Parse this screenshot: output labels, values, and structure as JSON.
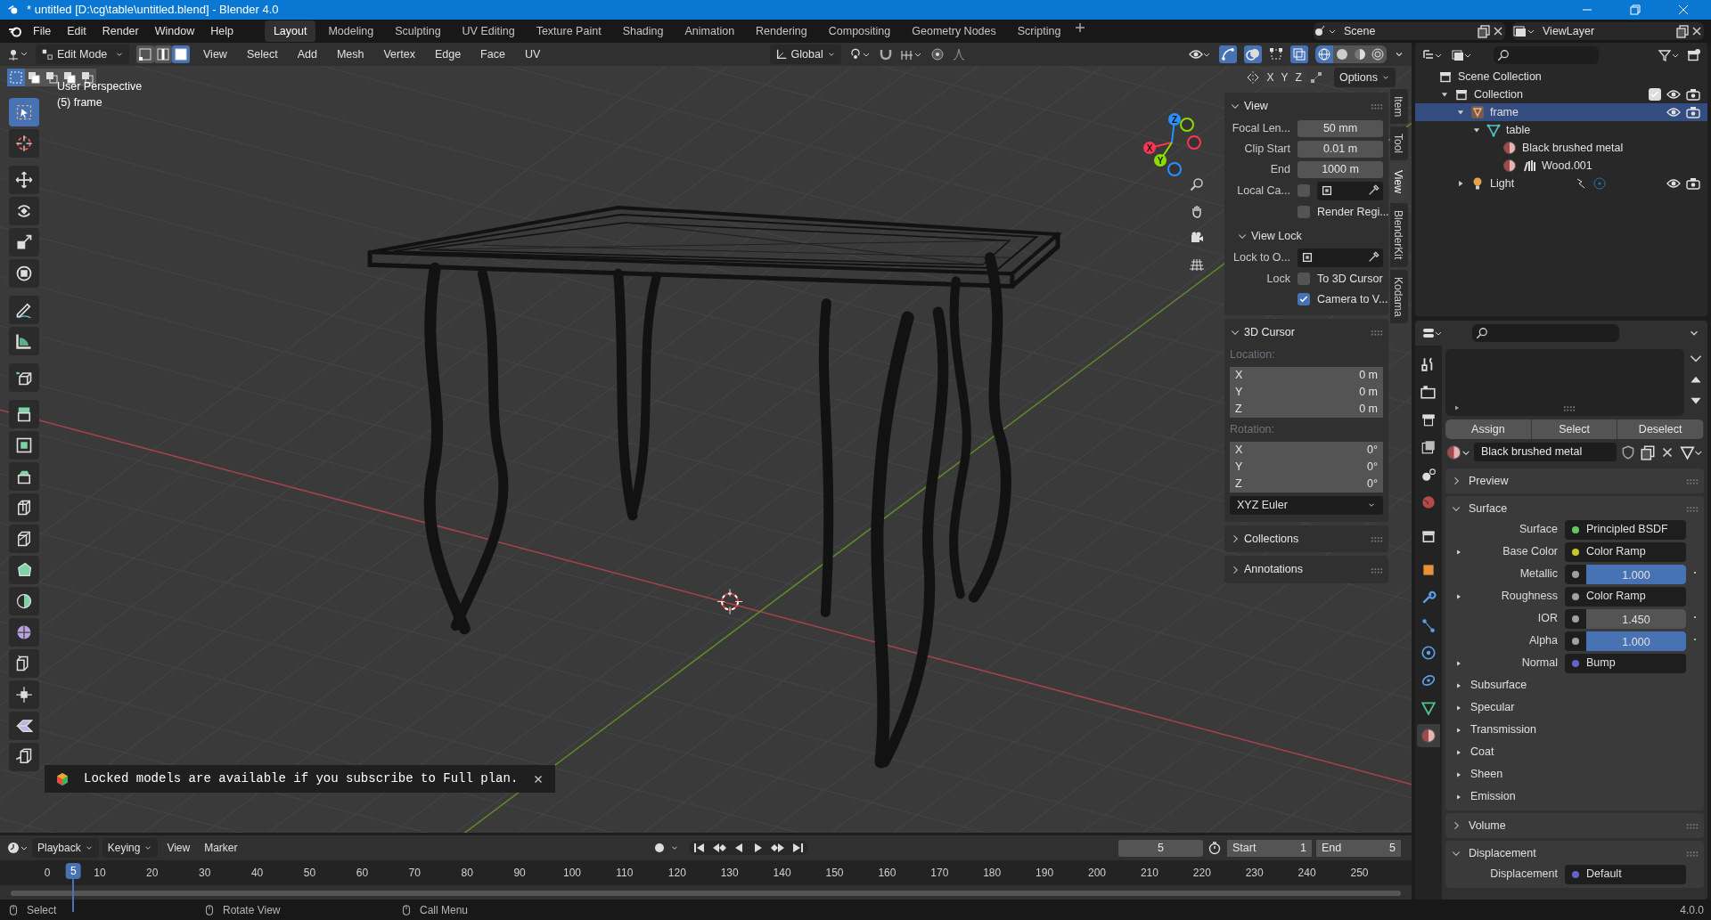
{
  "title_bar": {
    "title": "* untitled [D:\\cg\\table\\untitled.blend] - Blender 4.0"
  },
  "menu": [
    "File",
    "Edit",
    "Render",
    "Window",
    "Help"
  ],
  "workspaces": [
    {
      "label": "Layout",
      "selected": true
    },
    {
      "label": "Modeling",
      "selected": false
    },
    {
      "label": "Sculpting",
      "selected": false
    },
    {
      "label": "UV Editing",
      "selected": false
    },
    {
      "label": "Texture Paint",
      "selected": false
    },
    {
      "label": "Shading",
      "selected": false
    },
    {
      "label": "Animation",
      "selected": false
    },
    {
      "label": "Rendering",
      "selected": false
    },
    {
      "label": "Compositing",
      "selected": false
    },
    {
      "label": "Geometry Nodes",
      "selected": false
    },
    {
      "label": "Scripting",
      "selected": false
    }
  ],
  "scene": "Scene",
  "view_layer": "ViewLayer",
  "header": {
    "mode": "Edit Mode",
    "select_modes": [
      {
        "kind": "vertex",
        "selected": false
      },
      {
        "kind": "edge",
        "selected": false
      },
      {
        "kind": "face",
        "selected": true
      }
    ],
    "menus": [
      "View",
      "Select",
      "Add",
      "Mesh",
      "Vertex",
      "Edge",
      "Face",
      "UV"
    ],
    "orientation": "Global",
    "shading": [
      {
        "kind": "wireframe",
        "selected": true
      },
      {
        "kind": "solid",
        "selected": false
      },
      {
        "kind": "material",
        "selected": false
      },
      {
        "kind": "rendered",
        "selected": false
      }
    ]
  },
  "tool_header": {
    "box_modes": [
      {
        "selected": true
      },
      {
        "selected": false
      },
      {
        "selected": false
      },
      {
        "selected": false
      },
      {
        "selected": false
      }
    ],
    "mirror": [
      "X",
      "Y",
      "Z"
    ],
    "options": "Options"
  },
  "viewport": {
    "perspective": "User Perspective",
    "object": "(5) frame",
    "gizmo": [
      {
        "label": "X",
        "color": "#ff3352"
      },
      {
        "label": "Y",
        "color": "#8bdc00"
      },
      {
        "label": "Z",
        "color": "#2890ff"
      }
    ]
  },
  "tools": [
    {
      "kind": "select",
      "selected": true
    },
    {
      "kind": "cursor",
      "selected": false
    },
    {
      "kind": "move",
      "selected": false
    },
    {
      "kind": "rotate",
      "selected": false
    },
    {
      "kind": "scale",
      "selected": false
    },
    {
      "kind": "transform",
      "selected": false
    },
    {
      "kind": "annotate",
      "selected": false
    },
    {
      "kind": "measure",
      "selected": false
    },
    {
      "kind": "add_cube",
      "selected": false
    },
    {
      "kind": "extrude",
      "selected": false
    },
    {
      "kind": "inset",
      "selected": false
    },
    {
      "kind": "bevel",
      "selected": false
    },
    {
      "kind": "loopcut",
      "selected": false
    },
    {
      "kind": "knife",
      "selected": false
    },
    {
      "kind": "polybuild",
      "selected": false
    },
    {
      "kind": "spin",
      "selected": false
    },
    {
      "kind": "smooth",
      "selected": false
    },
    {
      "kind": "slide",
      "selected": false
    },
    {
      "kind": "shrink",
      "selected": false
    },
    {
      "kind": "shear",
      "selected": false
    },
    {
      "kind": "rip",
      "selected": false
    }
  ],
  "notification": {
    "text": "Locked models are available if you subscribe to Full plan."
  },
  "sidebar": {
    "tabs": [
      {
        "label": "Item",
        "selected": false
      },
      {
        "label": "Tool",
        "selected": false
      },
      {
        "label": "View",
        "selected": true
      },
      {
        "label": "BlenderKit",
        "selected": false
      },
      {
        "label": "Kodama",
        "selected": false
      }
    ],
    "panels": [
      {
        "title": "View",
        "expanded": true,
        "rows": [
          {
            "kind": "number",
            "label": "Focal Len...",
            "value": "50 mm"
          },
          {
            "kind": "number",
            "label": "Clip Start",
            "value": "0.01 m"
          },
          {
            "kind": "number",
            "label": "End",
            "value": "1000 m"
          },
          {
            "kind": "check_object",
            "label": "Local Ca...",
            "checked": false
          },
          {
            "kind": "checkbox",
            "text": "Render Regi...",
            "checked": false
          },
          {
            "kind": "subheader",
            "title": "View Lock",
            "expanded": true
          },
          {
            "kind": "object",
            "label": "Lock to O..."
          },
          {
            "kind": "checkbox",
            "label": "Lock",
            "text": "To 3D Cursor",
            "checked": false
          },
          {
            "kind": "checkbox",
            "text": "Camera to V...",
            "checked": true
          }
        ]
      },
      {
        "title": "3D Cursor",
        "expanded": true,
        "rows": [
          {
            "kind": "heading",
            "text": "Location:"
          },
          {
            "kind": "vector",
            "axis": "X",
            "value": "0 m"
          },
          {
            "kind": "vector",
            "axis": "Y",
            "value": "0 m"
          },
          {
            "kind": "vector",
            "axis": "Z",
            "value": "0 m"
          },
          {
            "kind": "heading",
            "text": "Rotation:"
          },
          {
            "kind": "vector",
            "axis": "X",
            "value": "0°"
          },
          {
            "kind": "vector",
            "axis": "Y",
            "value": "0°"
          },
          {
            "kind": "vector",
            "axis": "Z",
            "value": "0°"
          },
          {
            "kind": "dropdown",
            "value": "XYZ Euler"
          }
        ]
      },
      {
        "title": "Collections",
        "expanded": false
      },
      {
        "title": "Annotations",
        "expanded": false
      }
    ]
  },
  "outliner": {
    "items": [
      {
        "label": "Scene Collection",
        "kind": "scene",
        "selected": false,
        "children": [
          {
            "label": "Collection",
            "kind": "collection",
            "expanded": true,
            "checked": true,
            "selected": false,
            "children": [
              {
                "label": "frame",
                "kind": "object",
                "expanded": true,
                "selected": true,
                "children": [
                  {
                    "label": "table",
                    "kind": "mesh",
                    "expanded": true,
                    "selected": false,
                    "children": [
                      {
                        "label": "Black brushed metal",
                        "kind": "material",
                        "selected": false
                      },
                      {
                        "label": "Wood.001",
                        "kind": "material_texture",
                        "selected": false
                      }
                    ]
                  }
                ]
              },
              {
                "label": "Light",
                "kind": "light",
                "expanded": false,
                "selected": false
              }
            ]
          }
        ]
      }
    ]
  },
  "properties": {
    "tabs": [
      {
        "kind": "tool",
        "selected": false
      },
      {
        "kind": "render",
        "selected": false
      },
      {
        "kind": "output",
        "selected": false
      },
      {
        "kind": "view_layer",
        "selected": false
      },
      {
        "kind": "scene",
        "selected": false
      },
      {
        "kind": "world",
        "selected": false
      },
      {
        "kind": "collection",
        "selected": false
      },
      {
        "kind": "object",
        "selected": false
      },
      {
        "kind": "modifier",
        "selected": false
      },
      {
        "kind": "particles",
        "selected": false
      },
      {
        "kind": "physics",
        "selected": false
      },
      {
        "kind": "constraints",
        "selected": false
      },
      {
        "kind": "data",
        "selected": false
      },
      {
        "kind": "material",
        "selected": true
      }
    ],
    "slot_buttons": [
      "Assign",
      "Select",
      "Deselect"
    ],
    "material": "Black brushed metal",
    "panels": [
      {
        "title": "Preview",
        "expanded": false
      },
      {
        "title": "Surface",
        "expanded": true,
        "rows": [
          {
            "kind": "link",
            "label": "Surface",
            "value": "Principled BSDF",
            "color": "#63c763",
            "expandable": false
          },
          {
            "kind": "link",
            "label": "Base Color",
            "value": "Color Ramp",
            "color": "#c7c729",
            "expandable": true
          },
          {
            "kind": "slider",
            "label": "Metallic",
            "value": "1.000",
            "level": 1,
            "color": "#a1a1a1"
          },
          {
            "kind": "link",
            "label": "Roughness",
            "value": "Color Ramp",
            "color": "#a1a1a1",
            "expandable": true
          },
          {
            "kind": "number",
            "label": "IOR",
            "value": "1.450",
            "color": "#a1a1a1"
          },
          {
            "kind": "slider",
            "label": "Alpha",
            "value": "1.000",
            "level": 1,
            "color": "#a1a1a1"
          },
          {
            "kind": "link",
            "label": "Normal",
            "value": "Bump",
            "color": "#6363c7",
            "expandable": true
          },
          {
            "kind": "sub",
            "label": "Subsurface"
          },
          {
            "kind": "sub",
            "label": "Specular"
          },
          {
            "kind": "sub",
            "label": "Transmission"
          },
          {
            "kind": "sub",
            "label": "Coat"
          },
          {
            "kind": "sub",
            "label": "Sheen"
          },
          {
            "kind": "sub",
            "label": "Emission"
          }
        ]
      },
      {
        "title": "Volume",
        "expanded": false
      },
      {
        "title": "Displacement",
        "expanded": true,
        "rows": [
          {
            "kind": "link",
            "label": "Displacement",
            "value": "Default",
            "color": "#6363c7",
            "expandable": false
          }
        ]
      }
    ]
  },
  "timeline": {
    "menus": [
      {
        "label": "Playback",
        "kind": "dropdown"
      },
      {
        "label": "Keying",
        "kind": "dropdown"
      },
      {
        "label": "View",
        "kind": "menu"
      },
      {
        "label": "Marker",
        "kind": "menu"
      }
    ],
    "current_frame": "5",
    "start_label": "Start",
    "start": "1",
    "end_label": "End",
    "end": "5",
    "ticks": [
      "0",
      "10",
      "20",
      "30",
      "40",
      "50",
      "60",
      "70",
      "80",
      "90",
      "100",
      "110",
      "120",
      "130",
      "140",
      "150",
      "160",
      "170",
      "180",
      "190",
      "200",
      "210",
      "220",
      "230",
      "240",
      "250"
    ],
    "playhead": "5"
  },
  "status_bar": {
    "items": [
      "Select",
      "Rotate View",
      "Call Menu"
    ],
    "version": "4.0.0"
  }
}
